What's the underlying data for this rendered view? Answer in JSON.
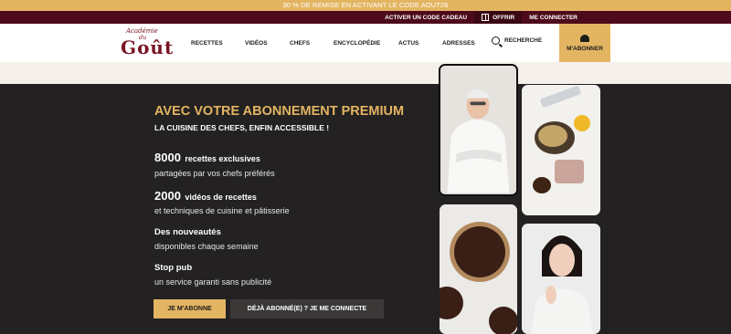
{
  "promo_bar": {
    "text": "30 % DE REMISE EN ACTIVANT LE CODE AOUT26"
  },
  "utility_bar": {
    "activate_code": "ACTIVER UN CODE CADEAU",
    "offer": "OFFRIR",
    "login": "ME CONNECTER"
  },
  "header": {
    "logo": {
      "line1": "Académie",
      "line2": "du",
      "line3": "Goût"
    },
    "nav": [
      "RECETTES",
      "VIDÉOS",
      "CHEFS",
      "ENCYCLOPÉDIE",
      "ACTUS",
      "ADRESSES"
    ],
    "search_label": "RECHERCHE",
    "subscribe_label": "M'ABONNER"
  },
  "premium": {
    "title": "AVEC VOTRE ABONNEMENT PREMIUM",
    "subtitle": "LA CUISINE DES CHEFS, ENFIN ACCESSIBLE !",
    "features": [
      {
        "number": "8000",
        "head": "recettes exclusives",
        "sub": "partagées par vos chefs préférés"
      },
      {
        "number": "2000",
        "head": "vidéos de recettes",
        "sub": "et techniques de cuisine et pâtisserie"
      },
      {
        "number": "",
        "head": "Des nouveautés",
        "sub": "disponibles chaque semaine"
      },
      {
        "number": "",
        "head": "Stop pub",
        "sub": "un service garanti sans publicité"
      }
    ],
    "cta_primary": "JE M'ABONNE",
    "cta_secondary": "DÉJÀ ABONNÉ(E) ? JE ME CONNECTE"
  },
  "colors": {
    "gold": "#e3b562",
    "burgundy": "#4d0a1c",
    "dark_bg": "#232121",
    "logo": "#7a1425"
  },
  "icons": [
    "gift-icon",
    "search-icon",
    "chef-hat-icon"
  ]
}
